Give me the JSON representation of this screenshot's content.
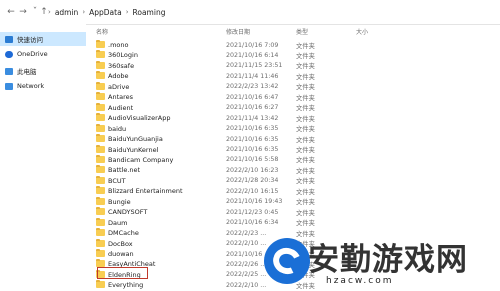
{
  "breadcrumb": {
    "items": [
      "admin",
      "AppData",
      "Roaming"
    ]
  },
  "sidebar": {
    "items": [
      {
        "label": "快速访问",
        "icon": "star-icon",
        "color": "#2b7cd3"
      },
      {
        "label": "OneDrive",
        "icon": "cloud-icon",
        "color": "#1e6ad6"
      },
      {
        "label": "此电脑",
        "icon": "computer-icon",
        "color": "#3a8de0"
      },
      {
        "label": "Network",
        "icon": "network-icon",
        "color": "#3a8de0"
      }
    ]
  },
  "columns": {
    "name": "名称",
    "date": "修改日期",
    "type": "类型",
    "size": "大小"
  },
  "files": [
    {
      "name": ".mono",
      "date": "2021/10/16 7:09",
      "type": "文件夹"
    },
    {
      "name": "360Login",
      "date": "2021/10/16 6:14",
      "type": "文件夹"
    },
    {
      "name": "360safe",
      "date": "2021/11/15 23:51",
      "type": "文件夹"
    },
    {
      "name": "Adobe",
      "date": "2021/11/4 11:46",
      "type": "文件夹"
    },
    {
      "name": "aDrive",
      "date": "2022/2/23 13:42",
      "type": "文件夹"
    },
    {
      "name": "Antares",
      "date": "2021/10/16 6:47",
      "type": "文件夹"
    },
    {
      "name": "Audient",
      "date": "2021/10/16 6:27",
      "type": "文件夹"
    },
    {
      "name": "AudioVisualizerApp",
      "date": "2021/11/4 13:42",
      "type": "文件夹"
    },
    {
      "name": "baidu",
      "date": "2021/10/16 6:35",
      "type": "文件夹"
    },
    {
      "name": "BaiduYunGuanjia",
      "date": "2021/10/16 6:35",
      "type": "文件夹"
    },
    {
      "name": "BaiduYunKernel",
      "date": "2021/10/16 6:35",
      "type": "文件夹"
    },
    {
      "name": "Bandicam Company",
      "date": "2021/10/16 5:58",
      "type": "文件夹"
    },
    {
      "name": "Battle.net",
      "date": "2022/2/10 16:23",
      "type": "文件夹"
    },
    {
      "name": "BCUT",
      "date": "2022/1/28 20:34",
      "type": "文件夹"
    },
    {
      "name": "Blizzard Entertainment",
      "date": "2022/2/10 16:15",
      "type": "文件夹"
    },
    {
      "name": "Bungie",
      "date": "2021/10/16 19:43",
      "type": "文件夹"
    },
    {
      "name": "CANDYSOFT",
      "date": "2021/12/23 0:45",
      "type": "文件夹"
    },
    {
      "name": "Daum",
      "date": "2021/10/16 6:34",
      "type": "文件夹"
    },
    {
      "name": "DMCache",
      "date": "2022/2/23 ...",
      "type": "文件夹"
    },
    {
      "name": "DocBox",
      "date": "2022/2/10 ...",
      "type": "文件夹"
    },
    {
      "name": "duowan",
      "date": "2021/10/16 ...",
      "type": "文件夹"
    },
    {
      "name": "EasyAntiCheat",
      "date": "2022/2/26 ...",
      "type": "文件夹"
    },
    {
      "name": "EldenRing",
      "date": "2022/2/25 ...",
      "type": "文件夹"
    },
    {
      "name": "Everything",
      "date": "2022/2/10 ...",
      "type": "文件夹"
    }
  ],
  "watermark": {
    "text": "安勤游戏网",
    "url": "hzacw.com",
    "logo_color": "#1a6fd6"
  }
}
